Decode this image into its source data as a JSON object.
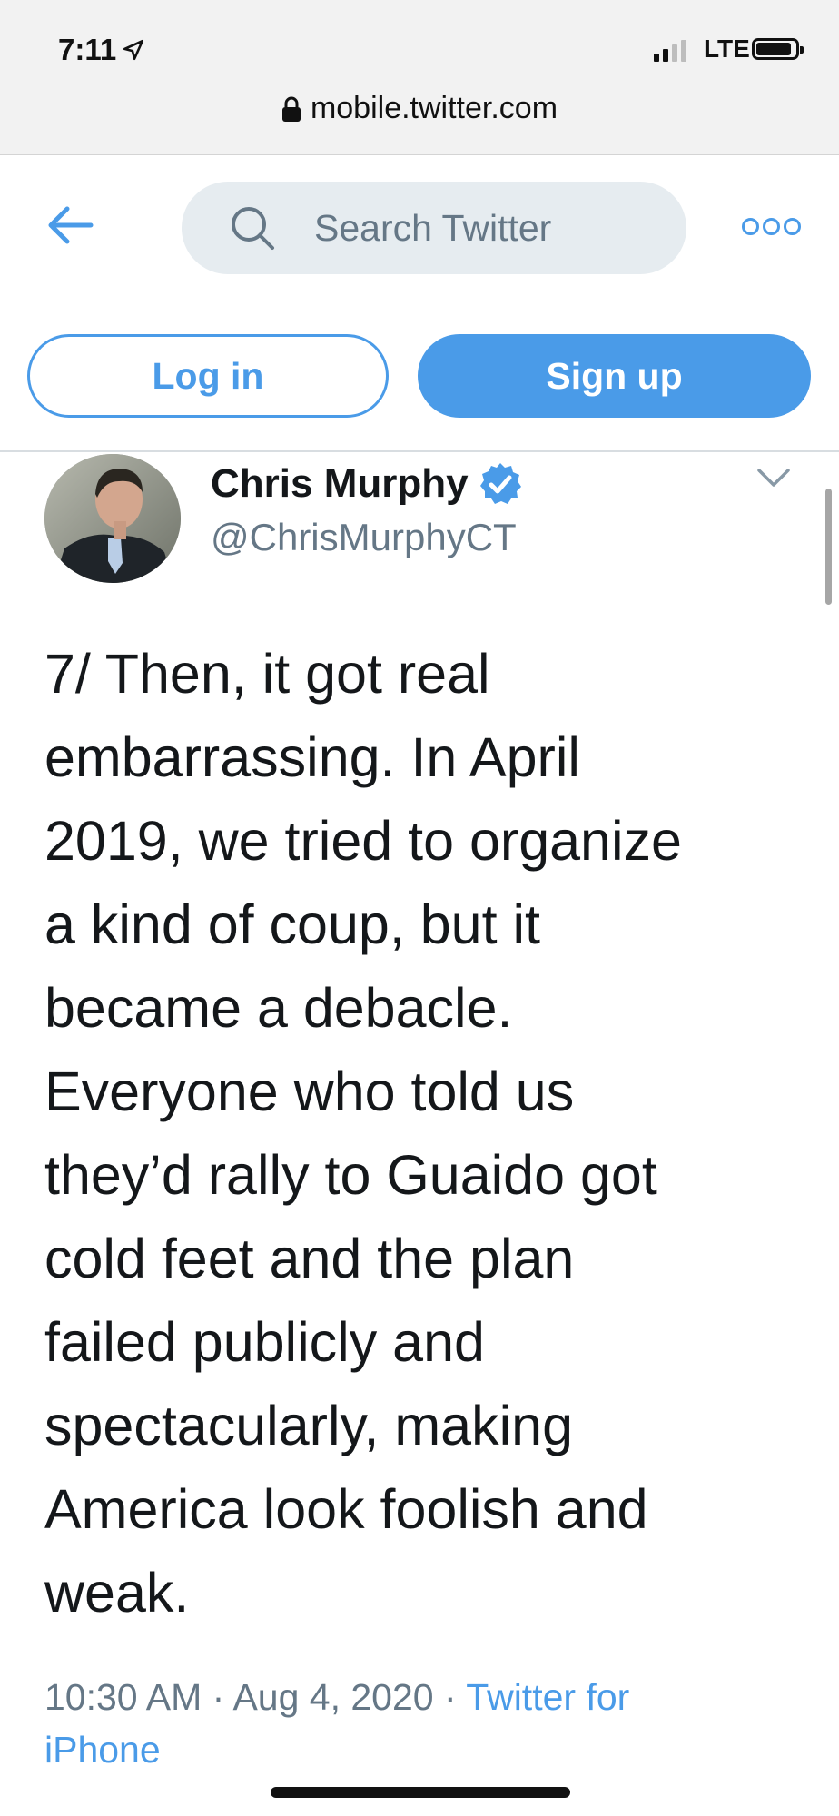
{
  "status_bar": {
    "time": "7:11",
    "network": "LTE",
    "signal_bars_active": 2,
    "signal_bars_total": 4,
    "battery_level": 0.9
  },
  "address_bar": {
    "url": "mobile.twitter.com"
  },
  "header": {
    "search_placeholder": "Search Twitter"
  },
  "auth": {
    "login_label": "Log in",
    "signup_label": "Sign up"
  },
  "tweet": {
    "author_name": "Chris Murphy",
    "author_handle": "@ChrisMurphyCT",
    "verified": true,
    "text": "7/ Then, it got real\nembarrassing. In April\n2019, we tried to organize\na kind of coup, but it\nbecame a debacle.\nEveryone who told us\nthey’d rally to Guaido got\ncold feet and the plan\nfailed publicly and\nspectacularly, making\nAmerica look foolish and\nweak.",
    "time": "10:30 AM",
    "date": "Aug 4, 2020",
    "source_line1": "Twitter for",
    "source_line2": "iPhone",
    "separator": "·"
  },
  "colors": {
    "accent": "#4a9be8",
    "muted_text": "#657786",
    "search_bg": "#e6ecf0"
  }
}
